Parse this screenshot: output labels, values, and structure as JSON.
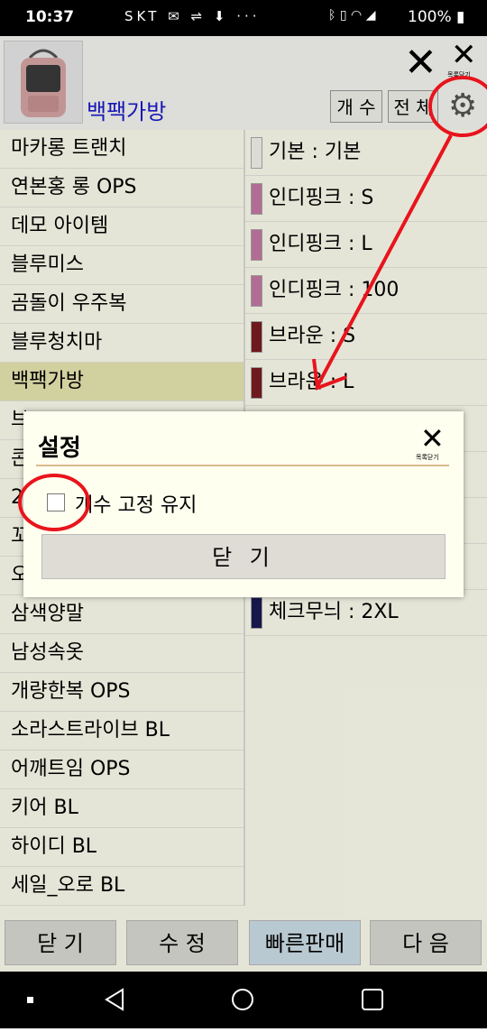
{
  "status": {
    "time": "10:37",
    "carrier": "SKT",
    "battery": "100%"
  },
  "header": {
    "product_name": "백팩가방",
    "count_button": "개 수",
    "all_button": "전 체",
    "close_caption": "목록닫기"
  },
  "left_list": [
    {
      "label": "마카롱 트랜치"
    },
    {
      "label": "연본홍  롱 OPS"
    },
    {
      "label": "데모 아이템"
    },
    {
      "label": "블루미스"
    },
    {
      "label": "곰돌이 우주복"
    },
    {
      "label": "블루청치마"
    },
    {
      "label": "백팩가방",
      "selected": true
    },
    {
      "label": "브"
    },
    {
      "label": "콘"
    },
    {
      "label": "2"
    },
    {
      "label": "꼬"
    },
    {
      "label": "오"
    },
    {
      "label": "삼색양말"
    },
    {
      "label": "남성속옷"
    },
    {
      "label": "개량한복 OPS"
    },
    {
      "label": "소라스트라이브 BL"
    },
    {
      "label": "어깨트임 OPS"
    },
    {
      "label": "키어 BL"
    },
    {
      "label": "하이디 BL"
    },
    {
      "label": "세일_오로 BL"
    }
  ],
  "right_list": [
    {
      "label": "기본 : 기본",
      "color": "#f5f5f0"
    },
    {
      "label": "인디핑크 : S",
      "color": "#c77aa6"
    },
    {
      "label": "인디핑크 : L",
      "color": "#c77aa6"
    },
    {
      "label": "인디핑크 : 100",
      "color": "#c77aa6"
    },
    {
      "label": "브라운 : S",
      "color": "#7a1c22"
    },
    {
      "label": "브라운 : L",
      "color": "#7a1c22"
    },
    {
      "label": "",
      "color": ""
    },
    {
      "label": "",
      "color": ""
    },
    {
      "label": "",
      "color": ""
    },
    {
      "label": "",
      "color": ""
    },
    {
      "label": "체크무늬 : 2XL",
      "color": "#1a1a55"
    }
  ],
  "bottom_buttons": {
    "close": "닫 기",
    "edit": "수 정",
    "quick_sale": "빠른판매",
    "next": "다 음"
  },
  "dialog": {
    "title": "설정",
    "close_caption": "목록닫기",
    "checkbox_label": "개수 고정 유지",
    "checkbox_checked": false,
    "close_button": "닫 기"
  },
  "annotation_color": "#e8141c"
}
